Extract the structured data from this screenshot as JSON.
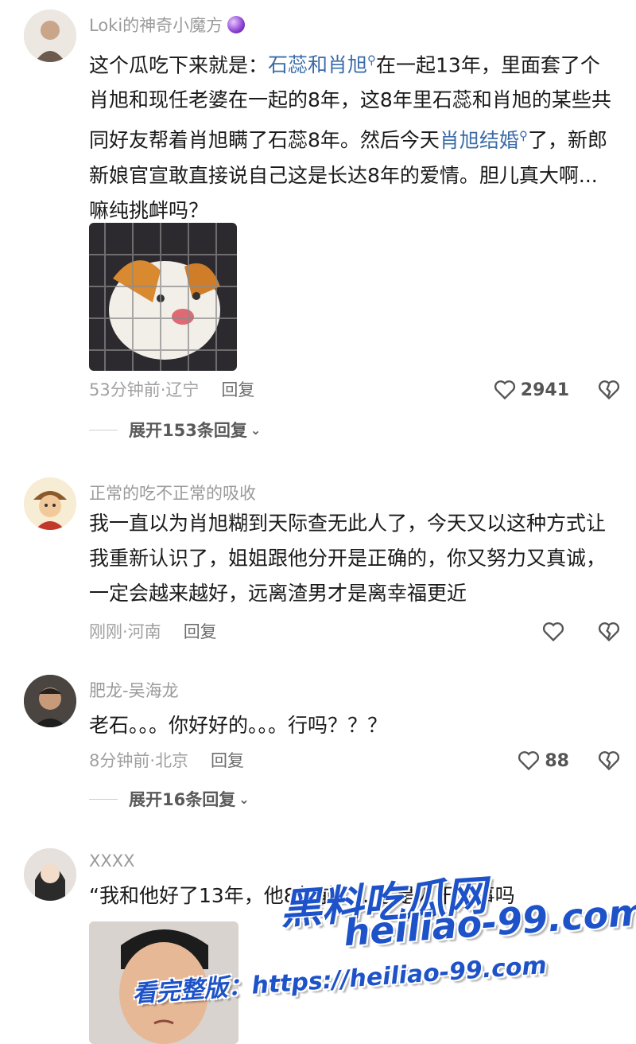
{
  "comments": [
    {
      "username": "Loki的神奇小魔方",
      "content_parts": [
        {
          "text": "这个瓜吃下来就是：",
          "kw": false
        },
        {
          "text": "石蕊和肖旭",
          "kw": true
        },
        {
          "text": "在一起13年，里面套了个肖旭和现任老婆在一起的8年，这8年里石蕊和肖旭的某些共同好友帮着肖旭瞒了石蕊8年。然后今天",
          "kw": false
        },
        {
          "text": "肖旭结婚",
          "kw": true
        },
        {
          "text": "了，新郎新娘官宣敢直接说自己这是长达8年的爱情。胆儿真大啊...嘛纯挑衅吗？",
          "kw": false
        }
      ],
      "time_location": "53分钟前·辽宁",
      "reply_label": "回复",
      "likes": "2941",
      "expand_label": "展开153条回复"
    },
    {
      "username": "正常的吃不正常的吸收",
      "content": "我一直以为肖旭糊到天际查无此人了，今天又以这种方式让我重新认识了，姐姐跟他分开是正确的，你又努力又真诚，一定会越来越好，远离渣男才是离幸福更近",
      "time_location": "刚刚·河南",
      "reply_label": "回复",
      "likes": ""
    },
    {
      "username": "肥龙-吴海龙",
      "content": "老石。。。你好好的。。。行吗？？？",
      "time_location": "8分钟前·北京",
      "reply_label": "回复",
      "likes": "88",
      "expand_label": "展开16条回复"
    },
    {
      "username": "XXXX",
      "content": "“我和他好了13年，他8年前……这是人干的事吗"
    }
  ],
  "watermark": {
    "brand": "黑料吃瓜网",
    "url": "heiliao-99.com",
    "prefix": "看完整版：https://heiliao-99.com"
  },
  "colors": {
    "keyword": "#3b6ca8",
    "meta": "#a0a0a0",
    "watermark": "#1d52c9"
  }
}
